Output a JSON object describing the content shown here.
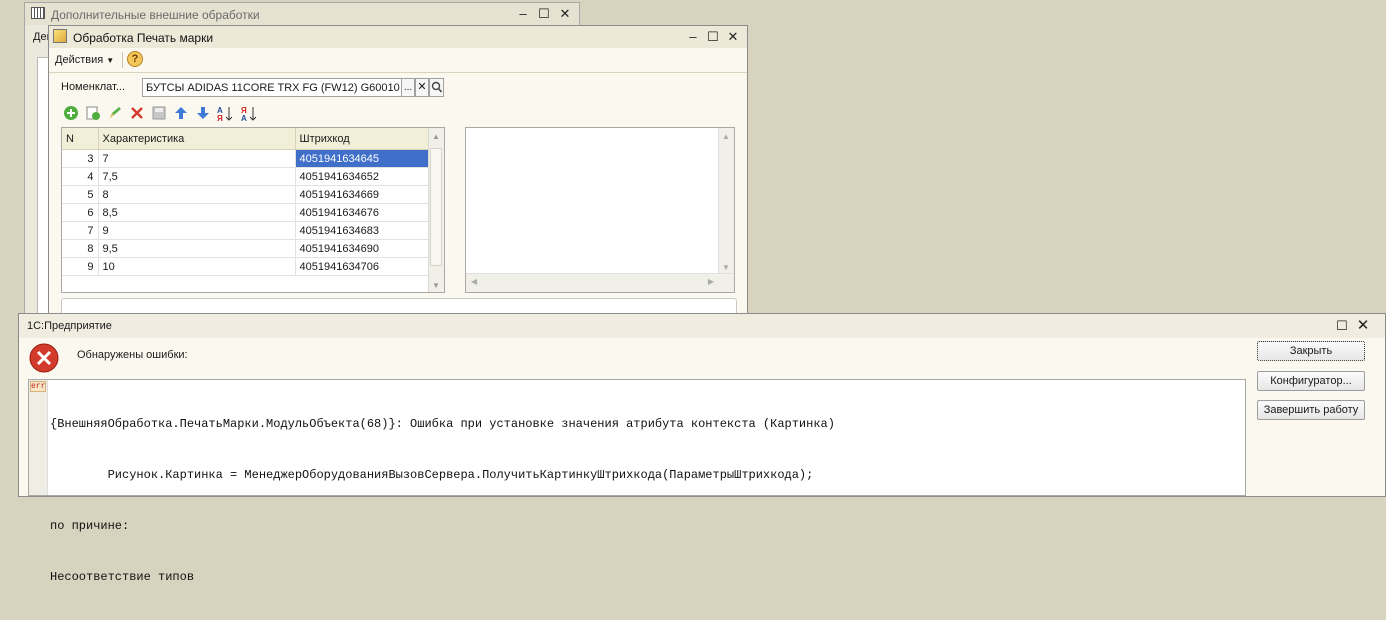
{
  "back_window": {
    "title": "Дополнительные внешние обработки",
    "menu_partial": "Дей"
  },
  "front_window": {
    "title": "Обработка  Печать марки",
    "actions_label": "Действия",
    "help_label": "?",
    "nomenclature_label": "Номенклат...",
    "nomenclature_value": "БУТСЫ ADIDAS 11CORE TRX FG (FW12) G60010",
    "select_label": "...",
    "clear_label": "✕",
    "table": {
      "columns": [
        "N",
        "Характеристика",
        "Штрихкод"
      ],
      "rows": [
        {
          "n": "3",
          "char": "7",
          "barcode": "4051941634645",
          "selected": true
        },
        {
          "n": "4",
          "char": "7,5",
          "barcode": "4051941634652"
        },
        {
          "n": "5",
          "char": "8",
          "barcode": "4051941634669"
        },
        {
          "n": "6",
          "char": "8,5",
          "barcode": "4051941634676"
        },
        {
          "n": "7",
          "char": "9",
          "barcode": "4051941634683"
        },
        {
          "n": "8",
          "char": "9,5",
          "barcode": "4051941634690"
        },
        {
          "n": "9",
          "char": "10",
          "barcode": "4051941634706"
        }
      ]
    }
  },
  "error_dialog": {
    "title": "1С:Предприятие",
    "heading": "Обнаружены ошибки:",
    "err_tag": "err",
    "lines": [
      "{ВнешняяОбработка.ПечатьМарки.МодульОбъекта(68)}: Ошибка при установке значения атрибута контекста (Картинка)",
      "        Рисунок.Картинка = МенеджерОборудованияВызовСервера.ПолучитьКартинкуШтрихкода(ПараметрыШтрихкода);",
      "по причине:",
      "Несоответствие типов"
    ],
    "buttons": {
      "close": "Закрыть",
      "configurator": "Конфигуратор...",
      "finish": "Завершить работу"
    }
  },
  "colors": {
    "window_bg": "#fbf9ef",
    "desktop": "#d8d3be",
    "selection": "#3f6fc8",
    "error_red": "#d23b2b"
  }
}
